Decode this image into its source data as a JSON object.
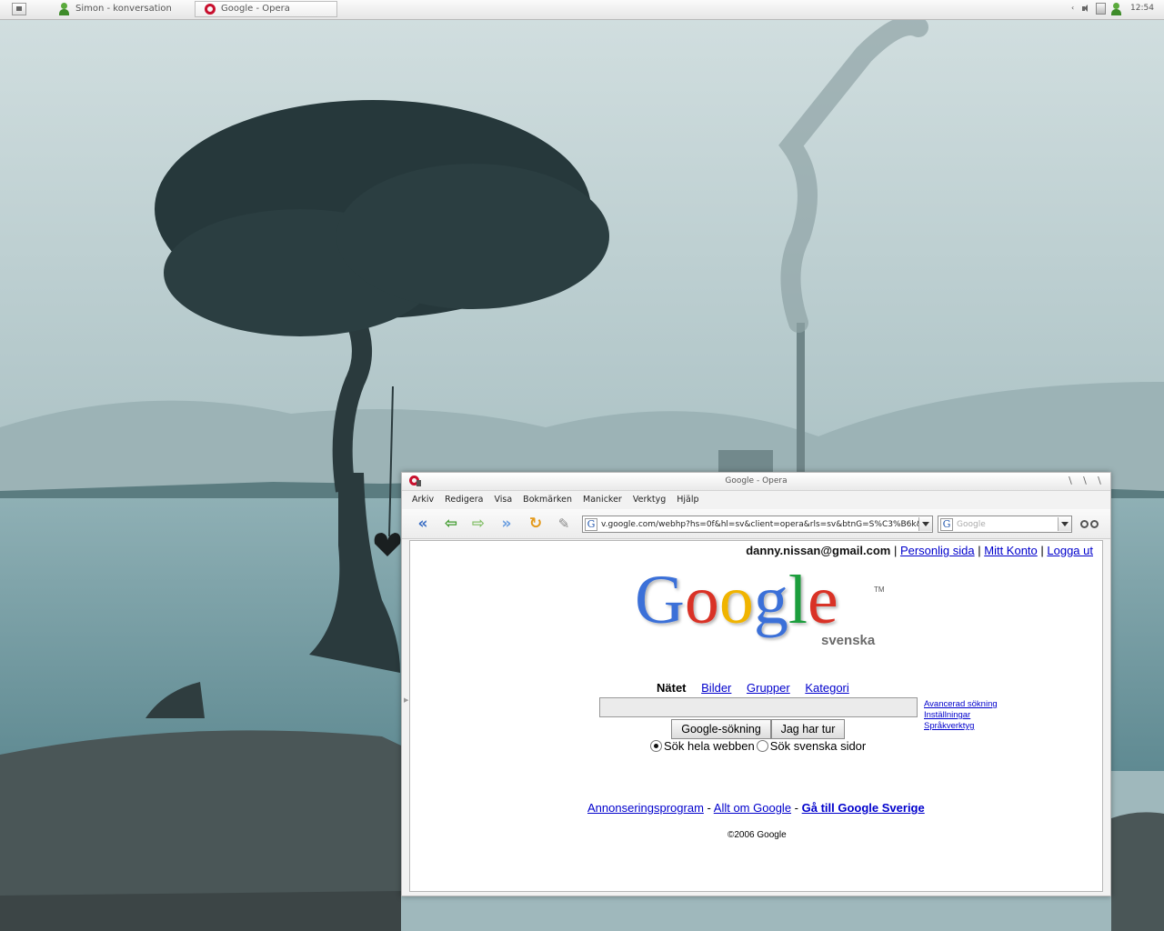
{
  "taskbar": {
    "tasks": [
      {
        "label": "Simon - konversation",
        "icon": "person-icon"
      },
      {
        "label": "Google - Opera",
        "icon": "opera-icon"
      }
    ],
    "clock": "12:54"
  },
  "window": {
    "title": "Google - Opera",
    "menu": [
      "Arkiv",
      "Redigera",
      "Visa",
      "Bokmärken",
      "Manicker",
      "Verktyg",
      "Hjälp"
    ],
    "address": "v.google.com/webhp?hs=0f&hl=sv&client=opera&rls=sv&btnG=S%C3%B6k&lr=",
    "search_placeholder": "Google"
  },
  "page": {
    "user_email": "danny.nissan@gmail.com",
    "user_links": [
      "Personlig sida",
      "Mitt Konto",
      "Logga ut"
    ],
    "logo_text": "Google",
    "logo_tm": "TM",
    "logo_sub": "svenska",
    "tabs": {
      "active": "Nätet",
      "links": [
        "Bilder",
        "Grupper",
        "Kategori"
      ]
    },
    "query_value": "",
    "side_links": [
      "Avancerad sökning",
      "Inställningar",
      "Språkverktyg"
    ],
    "buttons": {
      "search": "Google-sökning",
      "lucky": "Jag har tur"
    },
    "radios": [
      {
        "label": "Sök hela webben",
        "checked": true
      },
      {
        "label": "Sök svenska sidor",
        "checked": false
      }
    ],
    "footer": {
      "ads": "Annonseringsprogram",
      "about": "Allt om Google",
      "sweden": "Gå till Google Sverige",
      "separator": "-"
    },
    "copyright": "©2006 Google"
  },
  "colors": {
    "link": "#0000cc",
    "opera_red": "#c8102e",
    "google_blue": "#3a6fd8",
    "google_red": "#d93025",
    "google_yellow": "#f0b400",
    "google_green": "#1e9e3e"
  }
}
